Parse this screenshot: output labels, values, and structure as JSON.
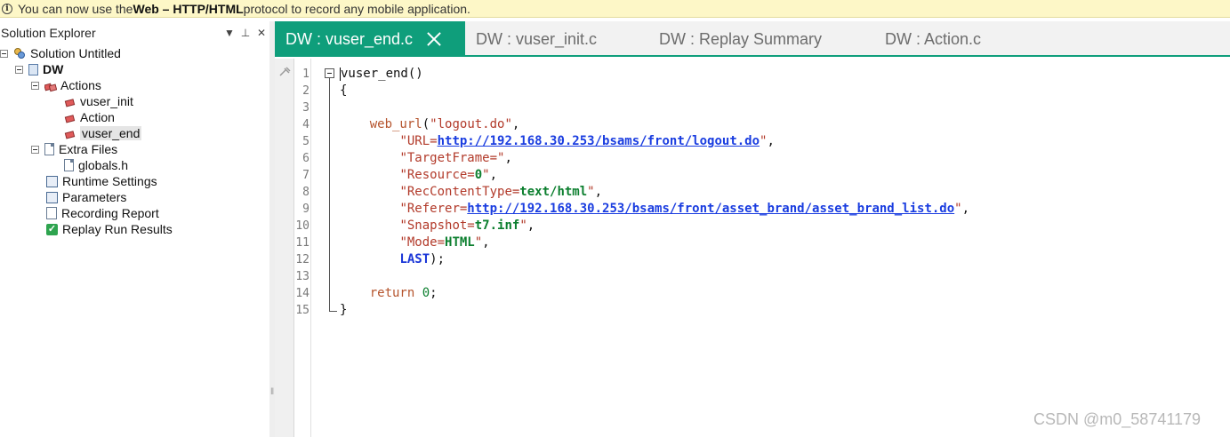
{
  "infobar": {
    "icon": "info-icon",
    "prefix": "You can now use the ",
    "bold": "Web – HTTP/HTML",
    "suffix": " protocol to record any mobile application."
  },
  "explorer": {
    "title": "Solution Explorer",
    "buttons": [
      "▼",
      "⊥",
      "✕"
    ],
    "tree": {
      "solution": "Solution Untitled",
      "project": "DW",
      "actions": "Actions",
      "action_items": [
        "vuser_init",
        "Action",
        "vuser_end"
      ],
      "extra_files": "Extra Files",
      "extra_items": [
        "globals.h"
      ],
      "runtime_settings": "Runtime Settings",
      "parameters": "Parameters",
      "recording_report": "Recording Report",
      "replay_results": "Replay Run Results"
    }
  },
  "tabs": [
    {
      "label": "DW : vuser_end.c",
      "active": true
    },
    {
      "label": "DW : vuser_init.c",
      "active": false
    },
    {
      "label": "DW : Replay Summary",
      "active": false
    },
    {
      "label": "DW : Action.c",
      "active": false
    }
  ],
  "editor": {
    "line_numbers": [
      "1",
      "2",
      "3",
      "4",
      "5",
      "6",
      "7",
      "8",
      "9",
      "10",
      "11",
      "12",
      "13",
      "14",
      "15"
    ],
    "code": {
      "l1": "vuser_end()",
      "l2": "{",
      "l4_fn": "web_url",
      "l4_arg": "\"logout.do\"",
      "l5_key": "\"URL=",
      "l5_val": "http://192.168.30.253/bsams/front/logout.do",
      "l6": "\"TargetFrame=\"",
      "l7_key": "\"Resource=",
      "l7_val": "0",
      "l8_key": "\"RecContentType=",
      "l8_val": "text/html",
      "l9_key": "\"Referer=",
      "l9_val": "http://192.168.30.253/bsams/front/asset_brand/asset_brand_list.do",
      "l10_key": "\"Snapshot=",
      "l10_val": "t7.inf",
      "l11_key": "\"Mode=",
      "l11_val": "HTML",
      "l12": "LAST",
      "l14_kw": "return",
      "l14_num": "0",
      "l15": "}"
    }
  },
  "watermark": "CSDN @m0_58741179",
  "colors": {
    "accent": "#0f9e7b",
    "infobar_bg": "#fdf7c7",
    "keyword": "#b5542d",
    "url": "#1a3de0",
    "value": "#0c7f2f"
  }
}
